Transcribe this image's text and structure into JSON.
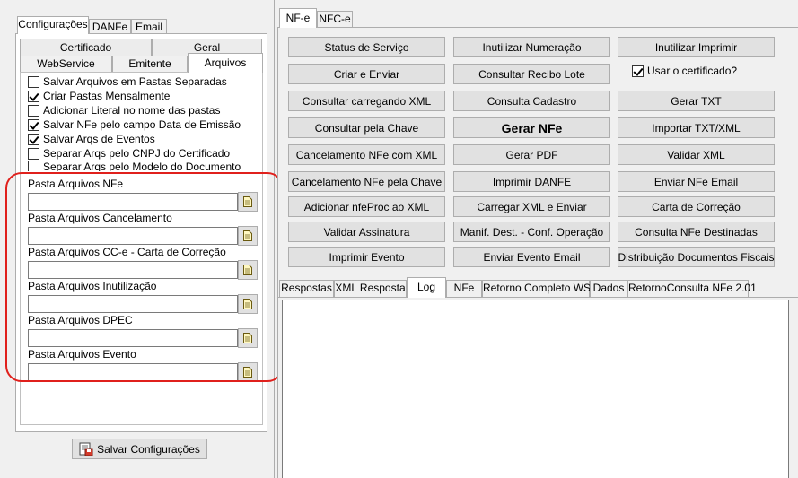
{
  "left": {
    "top_tabs": [
      "Configurações",
      "DANFe",
      "Email"
    ],
    "sub_tabs_row1": [
      "Certificado",
      "Geral"
    ],
    "sub_tabs_row2": [
      "WebService",
      "Emitente",
      "Arquivos"
    ],
    "checkboxes": [
      {
        "label": "Salvar Arquivos em Pastas Separadas",
        "checked": false
      },
      {
        "label": "Criar Pastas Mensalmente",
        "checked": true
      },
      {
        "label": "Adicionar Literal no nome das pastas",
        "checked": false
      },
      {
        "label": "Salvar NFe pelo campo Data de Emissão",
        "checked": true
      },
      {
        "label": "Salvar Arqs de Eventos",
        "checked": true
      },
      {
        "label": "Separar Arqs pelo CNPJ do Certificado",
        "checked": false
      },
      {
        "label": "Separar Arqs pelo Modelo do Documento",
        "checked": false
      }
    ],
    "fields": [
      {
        "label": "Pasta Arquivos NFe",
        "value": ""
      },
      {
        "label": "Pasta Arquivos Cancelamento",
        "value": ""
      },
      {
        "label": "Pasta Arquivos CC-e - Carta de Correção",
        "value": ""
      },
      {
        "label": "Pasta Arquivos Inutilização",
        "value": ""
      },
      {
        "label": "Pasta Arquivos DPEC",
        "value": ""
      },
      {
        "label": "Pasta Arquivos Evento",
        "value": ""
      }
    ],
    "save_button": "Salvar Configurações"
  },
  "right": {
    "top_tabs": [
      "NF-e",
      "NFC-e"
    ],
    "buttons": {
      "col1": [
        "Status de Serviço",
        "Criar e Enviar",
        "Consultar carregando XML",
        "Consultar pela Chave",
        "Cancelamento NFe com XML",
        "Cancelamento NFe pela Chave",
        "Adicionar nfeProc ao XML",
        "Validar Assinatura",
        "Imprimir Evento"
      ],
      "col2": [
        "Inutilizar Numeração",
        "Consultar Recibo Lote",
        "Consulta Cadastro",
        "Gerar NFe",
        "Gerar PDF",
        "Imprimir DANFE",
        "Carregar XML e Enviar",
        "Manif. Dest. - Conf. Operação",
        "Enviar Evento Email"
      ],
      "col3": [
        "Inutilizar Imprimir",
        "Gerar TXT",
        "Importar TXT/XML",
        "Validar XML",
        "Enviar NFe Email",
        "Carta de Correção",
        "Consulta NFe Destinadas",
        "Distribuição Documentos Fiscais"
      ]
    },
    "use_cert": {
      "label": "Usar o certificado?",
      "checked": true
    },
    "bottom_tabs": [
      "Respostas",
      "XML Resposta",
      "Log",
      "NFe",
      "Retorno Completo WS",
      "Dados",
      "RetornoConsulta NFe 2.01"
    ],
    "active_bottom_tab": "Log"
  },
  "colors": {
    "highlight_outline": "#e0201c",
    "button_face": "#e1e1e1",
    "border": "#adadad"
  }
}
